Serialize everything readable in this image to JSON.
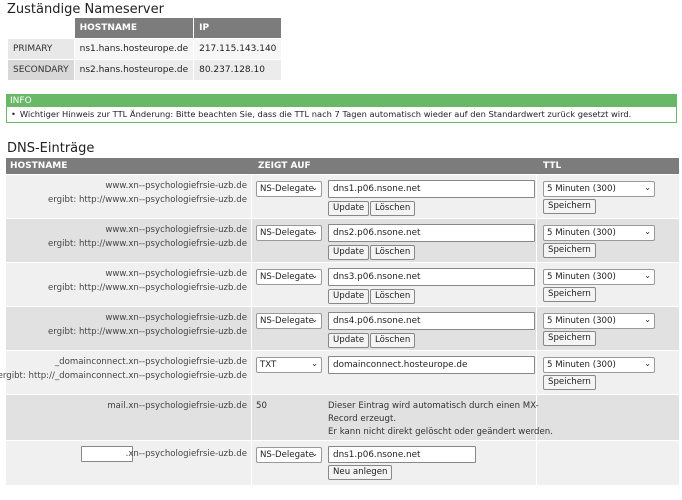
{
  "nameserver": {
    "title": "Zuständige Nameserver",
    "columns": [
      "HOSTNAME",
      "IP"
    ],
    "rows": [
      {
        "label": "PRIMARY",
        "hostname": "ns1.hans.hosteurope.de",
        "ip": "217.115.143.140"
      },
      {
        "label": "SECONDARY",
        "hostname": "ns2.hans.hosteurope.de",
        "ip": "80.237.128.10"
      }
    ]
  },
  "info": {
    "title": "INFO",
    "message": "Wichtiger Hinweis zur TTL Änderung: Bitte beachten Sie, dass die TTL nach 7 Tagen automatisch wieder auf den Standardwert zurück gesetzt wird."
  },
  "dns": {
    "title": "DNS-Einträge",
    "columns": [
      "HOSTNAME",
      "ZEIGT AUF",
      "TTL"
    ],
    "buttons": {
      "update": "Update",
      "delete": "Löschen",
      "save": "Speichern",
      "create": "Neu anlegen"
    },
    "records": [
      {
        "host": "www.xn--psychologiefrsie-uzb.de",
        "result": "ergibt: http://www.xn--psychologiefrsie-uzb.de",
        "type": "NS-Delegate",
        "target": "dns1.p06.nsone.net",
        "ttl": "5 Minuten (300)"
      },
      {
        "host": "www.xn--psychologiefrsie-uzb.de",
        "result": "ergibt: http://www.xn--psychologiefrsie-uzb.de",
        "type": "NS-Delegate",
        "target": "dns2.p06.nsone.net",
        "ttl": "5 Minuten (300)"
      },
      {
        "host": "www.xn--psychologiefrsie-uzb.de",
        "result": "ergibt: http://www.xn--psychologiefrsie-uzb.de",
        "type": "NS-Delegate",
        "target": "dns3.p06.nsone.net",
        "ttl": "5 Minuten (300)"
      },
      {
        "host": "www.xn--psychologiefrsie-uzb.de",
        "result": "ergibt: http://www.xn--psychologiefrsie-uzb.de",
        "type": "NS-Delegate",
        "target": "dns4.p06.nsone.net",
        "ttl": "5 Minuten (300)"
      },
      {
        "host": "_domainconnect.xn--psychologiefrsie-uzb.de",
        "result": "ergibt: http://_domainconnect.xn--psychologiefrsie-uzb.de",
        "type": "TXT",
        "target": "domainconnect.hosteurope.de",
        "ttl": "5 Minuten (300)"
      }
    ],
    "mx_record": {
      "host": "mail.xn--psychologiefrsie-uzb.de",
      "priority": "50",
      "note_line1": "Dieser Eintrag wird automatisch durch einen MX-",
      "note_line2": "Record erzeugt.",
      "note_line3": "Er kann nicht direkt gelöscht oder geändert werden."
    },
    "new_record": {
      "host_suffix": ".xn--psychologiefrsie-uzb.de",
      "host_value": "",
      "type": "NS-Delegate",
      "target": "dns1.p06.nsone.net"
    }
  }
}
